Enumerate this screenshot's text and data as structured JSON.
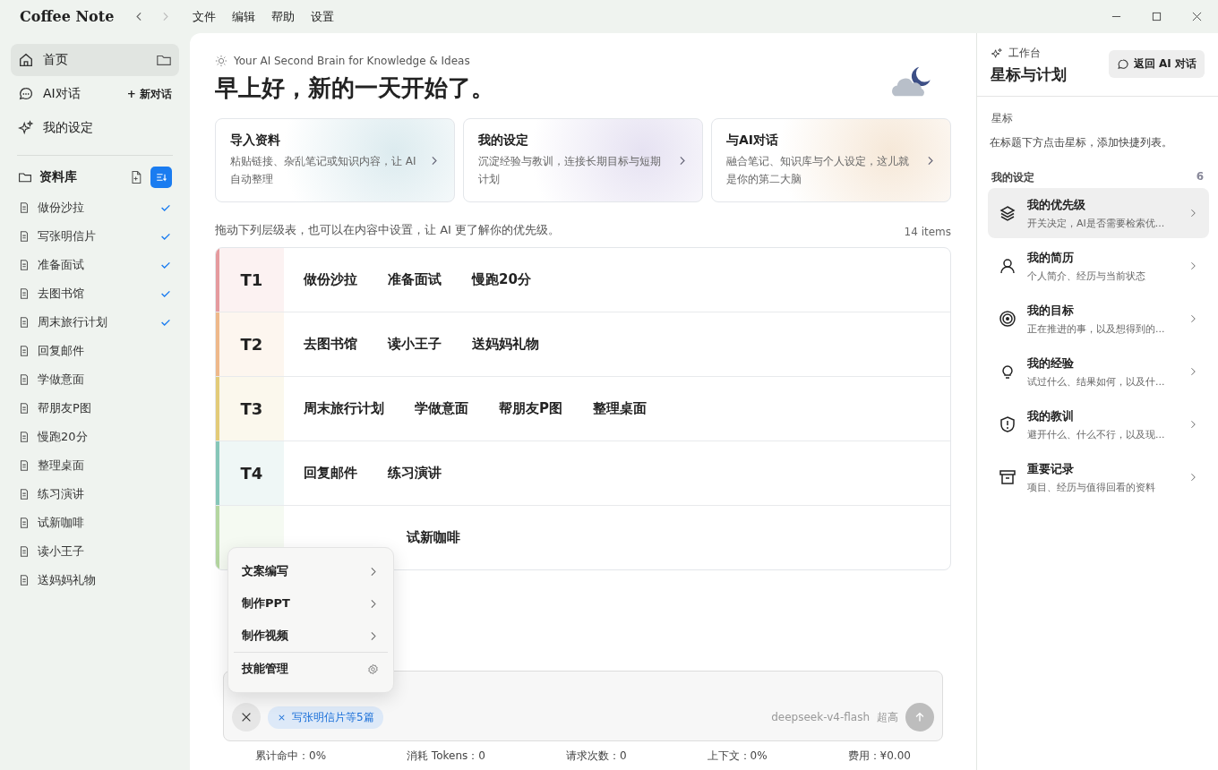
{
  "app": {
    "name": "Coffee Note"
  },
  "menu": [
    "文件",
    "编辑",
    "帮助",
    "设置"
  ],
  "nav": [
    {
      "label": "首页",
      "selected": true,
      "kind": "home"
    },
    {
      "label": "AI对话",
      "selected": false,
      "kind": "chat",
      "action": "+ 新对话"
    },
    {
      "label": "我的设定",
      "selected": false,
      "kind": "sparkle"
    }
  ],
  "library": {
    "title": "资料库",
    "sort_active": true,
    "items": [
      {
        "label": "做份沙拉",
        "checked": true
      },
      {
        "label": "写张明信片",
        "checked": true
      },
      {
        "label": "准备面试",
        "checked": true
      },
      {
        "label": "去图书馆",
        "checked": true
      },
      {
        "label": "周末旅行计划",
        "checked": true
      },
      {
        "label": "回复邮件",
        "checked": false
      },
      {
        "label": "学做意面",
        "checked": false
      },
      {
        "label": "帮朋友P图",
        "checked": false
      },
      {
        "label": "慢跑20分",
        "checked": false
      },
      {
        "label": "整理桌面",
        "checked": false
      },
      {
        "label": "练习演讲",
        "checked": false
      },
      {
        "label": "试新咖啡",
        "checked": false
      },
      {
        "label": "读小王子",
        "checked": false
      },
      {
        "label": "送妈妈礼物",
        "checked": false
      }
    ]
  },
  "hero": {
    "tagline": "Your AI Second Brain for Knowledge & Ideas",
    "greeting": "早上好，新的一天开始了。"
  },
  "cards": [
    {
      "title": "导入资料",
      "desc": "粘贴链接、杂乱笔记或知识内容，让 AI 自动整理",
      "color": "#dcebef"
    },
    {
      "title": "我的设定",
      "desc": "沉淀经验与教训，连接长期目标与短期计划",
      "color": "#e6e2f2"
    },
    {
      "title": "与AI对话",
      "desc": "融合笔记、知识库与个人设定，这儿就是你的第二大脑",
      "color": "#f6e8d8"
    }
  ],
  "tiers_hint": "拖动下列层级表，也可以在内容中设置，让 AI 更了解你的优先级。",
  "tiers_count": "14 items",
  "tiers": [
    {
      "label": "T1",
      "color": "#e59a9e",
      "items": [
        "做份沙拉",
        "准备面试",
        "慢跑20分"
      ]
    },
    {
      "label": "T2",
      "color": "#eeb88a",
      "items": [
        "去图书馆",
        "读小王子",
        "送妈妈礼物"
      ]
    },
    {
      "label": "T3",
      "color": "#e3cb78",
      "items": [
        "周末旅行计划",
        "学做意面",
        "帮朋友P图",
        "整理桌面"
      ]
    },
    {
      "label": "T4",
      "color": "#86c6b8",
      "items": [
        "回复邮件",
        "练习演讲"
      ]
    },
    {
      "color": "#b4d6a0",
      "items": [
        "试新咖啡"
      ]
    }
  ],
  "popup_menu": [
    {
      "label": "文案编写",
      "kind": "submenu"
    },
    {
      "label": "制作PPT",
      "kind": "submenu"
    },
    {
      "label": "制作视频",
      "kind": "submenu"
    },
    {
      "label": "技能管理",
      "kind": "settings"
    }
  ],
  "composer": {
    "attachment": "写张明信片等5篇",
    "model": "deepseek-v4-flash",
    "effort": "超高"
  },
  "stats": [
    "累计命中：0%",
    "消耗 Tokens：0",
    "请求次数：0",
    "上下文：0%",
    "费用：¥0.00"
  ],
  "right_panel": {
    "eyebrow": "工作台",
    "title": "星标与计划",
    "back_button": "返回 AI 对话",
    "starred_title": "星标",
    "starred_hint": "在标题下方点击星标，添加快捷列表。",
    "settings_title": "我的设定",
    "settings_count": "6",
    "settings": [
      {
        "title": "我的优先级",
        "desc": "开关决定，AI是否需要检索优...",
        "kind": "layers",
        "selected": true
      },
      {
        "title": "我的简历",
        "desc": "个人简介、经历与当前状态",
        "kind": "person",
        "selected": false
      },
      {
        "title": "我的目标",
        "desc": "正在推进的事，以及想得到的...",
        "kind": "target",
        "selected": false
      },
      {
        "title": "我的经验",
        "desc": "试过什么、结果如何，以及什...",
        "kind": "bulb",
        "selected": false
      },
      {
        "title": "我的教训",
        "desc": "避开什么、什么不行，以及现...",
        "kind": "shield",
        "selected": false
      },
      {
        "title": "重要记录",
        "desc": "项目、经历与值得回看的资料",
        "kind": "archive",
        "selected": false
      }
    ]
  }
}
